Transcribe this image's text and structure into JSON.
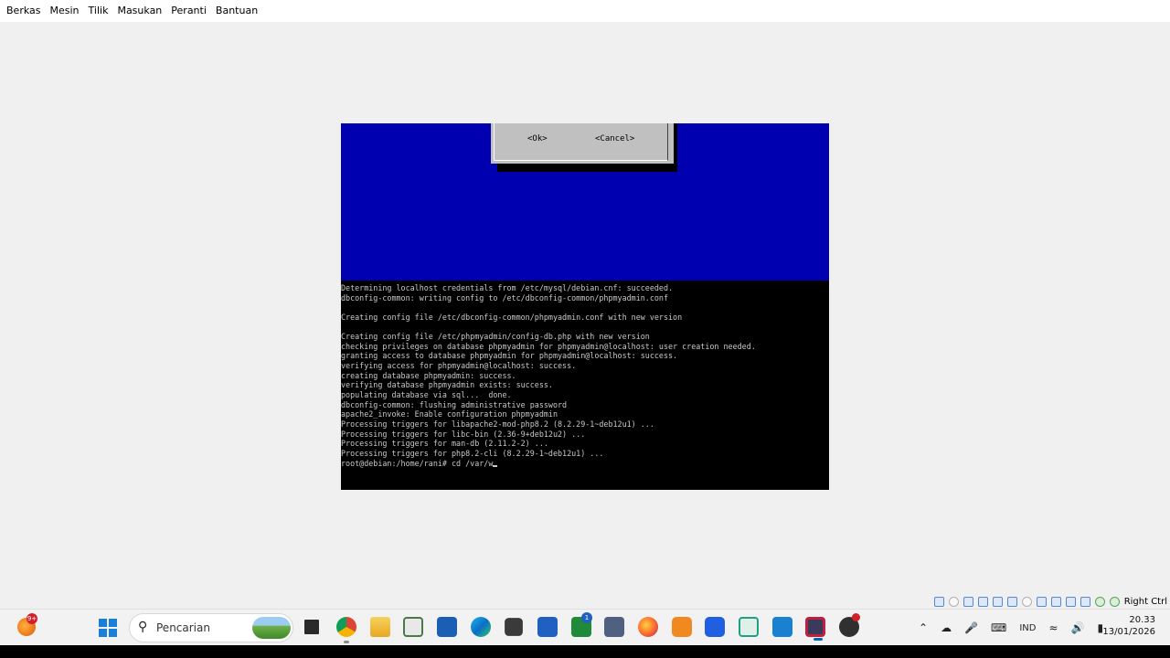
{
  "menubar": {
    "items": [
      "Berkas",
      "Mesin",
      "Tilik",
      "Masukan",
      "Peranti",
      "Bantuan"
    ]
  },
  "vm": {
    "dialog": {
      "ok_label": "<Ok>",
      "cancel_label": "<Cancel>"
    },
    "terminal": {
      "lines": [
        "Determining localhost credentials from /etc/mysql/debian.cnf: succeeded.",
        "dbconfig-common: writing config to /etc/dbconfig-common/phpmyadmin.conf",
        "",
        "Creating config file /etc/dbconfig-common/phpmyadmin.conf with new version",
        "",
        "Creating config file /etc/phpmyadmin/config-db.php with new version",
        "checking privileges on database phpmyadmin for phpmyadmin@localhost: user creation needed.",
        "granting access to database phpmyadmin for phpmyadmin@localhost: success.",
        "verifying access for phpmyadmin@localhost: success.",
        "creating database phpmyadmin: success.",
        "verifying database phpmyadmin exists: success.",
        "populating database via sql...  done.",
        "dbconfig-common: flushing administrative password",
        "apache2_invoke: Enable configuration phpmyadmin",
        "Processing triggers for libapache2-mod-php8.2 (8.2.29-1~deb12u1) ...",
        "Processing triggers for libc-bin (2.36-9+deb12u2) ...",
        "Processing triggers for man-db (2.11.2-2) ...",
        "Processing triggers for php8.2-cli (8.2.29-1~deb12u1) ..."
      ],
      "prompt": "root@debian:/home/rani# cd /var/w"
    },
    "colors": {
      "blue": "#0000b0",
      "dialog": "#c0c0c0",
      "terminal_text": "#c8c8c8"
    }
  },
  "statusbar": {
    "host_key": "Right Ctrl"
  },
  "taskbar": {
    "weather_badge": "9+",
    "search_placeholder": "Pencarian",
    "xbox_badge": "1",
    "tray": {
      "language": "IND"
    },
    "clock": {
      "time": "20.33",
      "date": "13/01/2026"
    },
    "accent": "#0067c0"
  }
}
